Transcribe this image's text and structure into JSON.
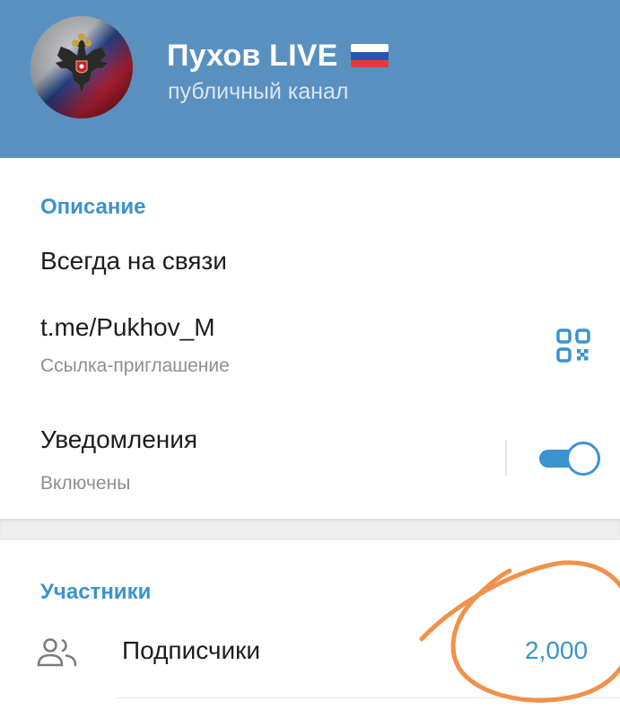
{
  "header": {
    "title": "Пухов LIVE",
    "subtitle": "публичный канал",
    "background_color": "#5a90c0"
  },
  "info": {
    "description_label": "Описание",
    "description_text": "Всегда на связи",
    "link_text": "t.me/Pukhov_M",
    "link_caption": "Ссылка-приглашение",
    "notifications_label": "Уведомления",
    "notifications_status": "Включены",
    "notifications_enabled": true
  },
  "members": {
    "section_label": "Участники",
    "subscribers_label": "Подписчики",
    "subscribers_count": "2,000"
  },
  "icons": {
    "avatar": "russian-coat-of-arms-avatar",
    "flag": "russia-flag-emoji",
    "qr": "qr-code-icon",
    "people": "people-icon"
  },
  "colors": {
    "accent": "#3b93cf",
    "annotation_stroke": "#f0924a"
  }
}
